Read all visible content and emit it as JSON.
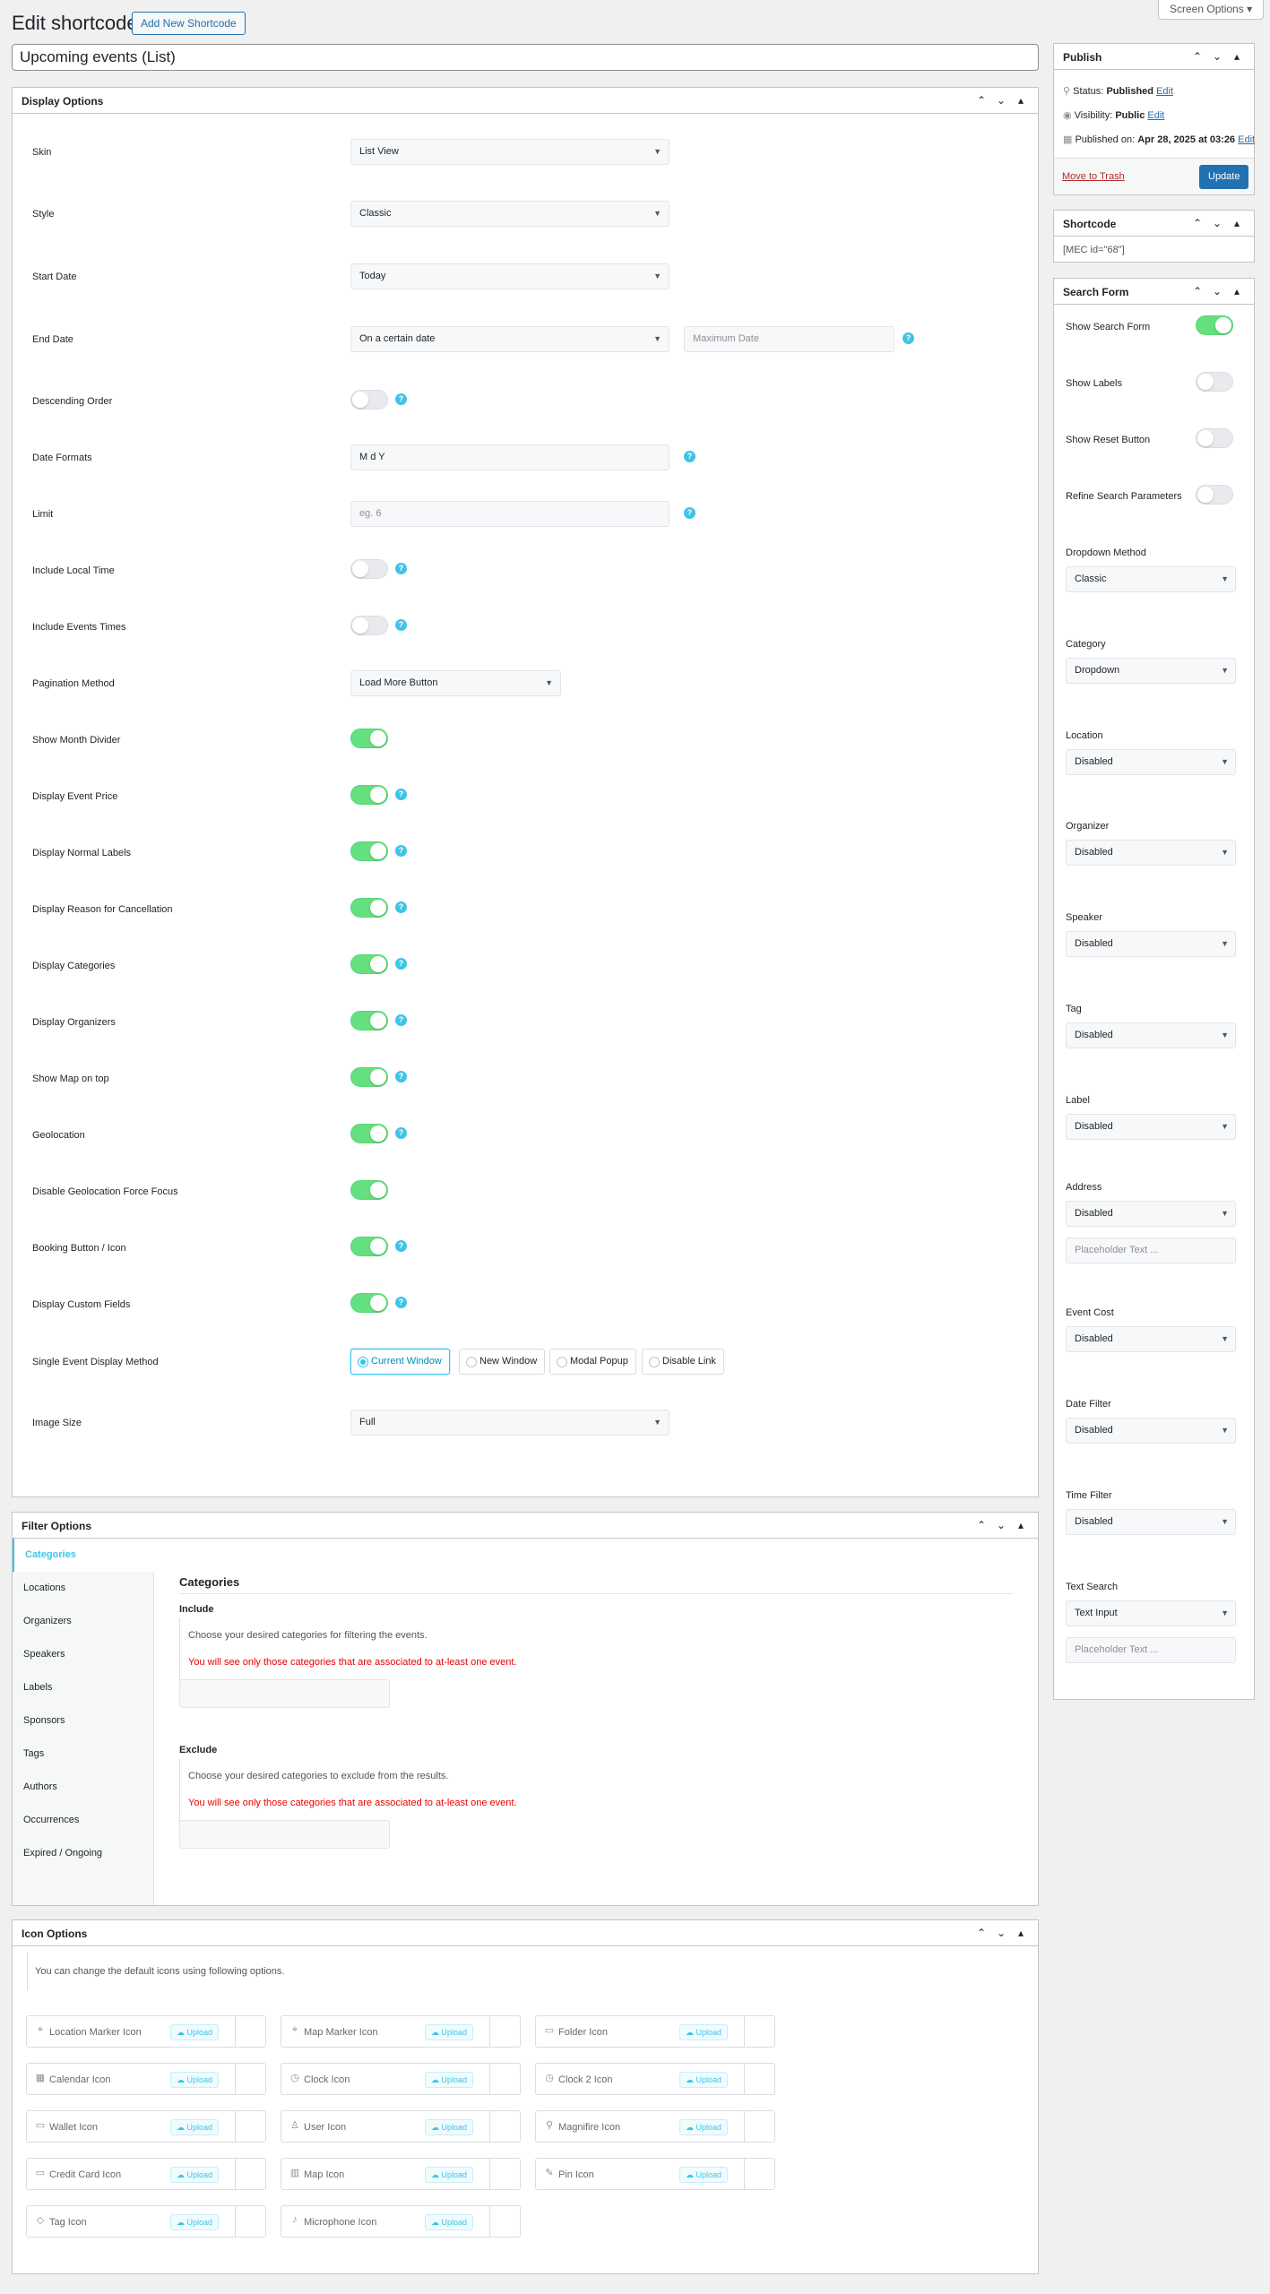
{
  "header": {
    "title": "Edit shortcodes",
    "add_new": "Add New Shortcode",
    "screen_options": "Screen Options"
  },
  "post_title": "Upcoming events (List)",
  "display_options": {
    "title": "Display Options",
    "skin": {
      "label": "Skin",
      "value": "List View"
    },
    "style": {
      "label": "Style",
      "value": "Classic"
    },
    "start_date": {
      "label": "Start Date",
      "value": "Today"
    },
    "end_date": {
      "label": "End Date",
      "value": "On a certain date",
      "max_placeholder": "Maximum Date"
    },
    "descending_order": {
      "label": "Descending Order",
      "on": false
    },
    "date_formats": {
      "label": "Date Formats",
      "value": "M d Y"
    },
    "limit": {
      "label": "Limit",
      "placeholder": "eg. 6"
    },
    "include_local_time": {
      "label": "Include Local Time",
      "on": false
    },
    "include_events_times": {
      "label": "Include Events Times",
      "on": false
    },
    "pagination": {
      "label": "Pagination Method",
      "value": "Load More Button"
    },
    "toggles": [
      {
        "label": "Show Month Divider",
        "on": true,
        "help": false
      },
      {
        "label": "Display Event Price",
        "on": true,
        "help": true
      },
      {
        "label": "Display Normal Labels",
        "on": true,
        "help": true
      },
      {
        "label": "Display Reason for Cancellation",
        "on": true,
        "help": true
      },
      {
        "label": "Display Categories",
        "on": true,
        "help": true
      },
      {
        "label": "Display Organizers",
        "on": true,
        "help": true
      },
      {
        "label": "Show Map on top",
        "on": true,
        "help": true
      },
      {
        "label": "Geolocation",
        "on": true,
        "help": true
      },
      {
        "label": "Disable Geolocation Force Focus",
        "on": true,
        "help": false
      },
      {
        "label": "Booking Button / Icon",
        "on": true,
        "help": true
      },
      {
        "label": "Display Custom Fields",
        "on": true,
        "help": true
      }
    ],
    "single_event": {
      "label": "Single Event Display Method",
      "options": [
        "Current Window",
        "New Window",
        "Modal Popup",
        "Disable Link"
      ],
      "selected": 0
    },
    "image_size": {
      "label": "Image Size",
      "value": "Full"
    }
  },
  "filter_options": {
    "title": "Filter Options",
    "tabs": [
      "Categories",
      "Locations",
      "Organizers",
      "Speakers",
      "Labels",
      "Sponsors",
      "Tags",
      "Authors",
      "Occurrences",
      "Expired / Ongoing"
    ],
    "active_tab": 0,
    "section_title": "Categories",
    "include": {
      "label": "Include",
      "desc": "Choose your desired categories for filtering the events.",
      "warn": "You will see only those categories that are associated to at-least one event."
    },
    "exclude": {
      "label": "Exclude",
      "desc": "Choose your desired categories to exclude from the results.",
      "warn": "You will see only those categories that are associated to at-least one event."
    }
  },
  "icon_options": {
    "title": "Icon Options",
    "desc": "You can change the default icons using following options.",
    "upload_label": "Upload",
    "items": [
      {
        "name": "Location Marker Icon",
        "icon": "location-marker-icon",
        "glyph": "⌖"
      },
      {
        "name": "Map Marker Icon",
        "icon": "map-marker-icon",
        "glyph": "⌖"
      },
      {
        "name": "Folder Icon",
        "icon": "folder-icon",
        "glyph": "▭"
      },
      {
        "name": "Calendar Icon",
        "icon": "calendar-icon",
        "glyph": "▦"
      },
      {
        "name": "Clock Icon",
        "icon": "clock-icon",
        "glyph": "◷"
      },
      {
        "name": "Clock 2 Icon",
        "icon": "clock-2-icon",
        "glyph": "◷"
      },
      {
        "name": "Wallet Icon",
        "icon": "wallet-icon",
        "glyph": "▭"
      },
      {
        "name": "User Icon",
        "icon": "user-icon",
        "glyph": "♙"
      },
      {
        "name": "Magnifire Icon",
        "icon": "magnifier-icon",
        "glyph": "⚲"
      },
      {
        "name": "Credit Card Icon",
        "icon": "credit-card-icon",
        "glyph": "▭"
      },
      {
        "name": "Map Icon",
        "icon": "map-icon",
        "glyph": "▥"
      },
      {
        "name": "Pin Icon",
        "icon": "pin-icon",
        "glyph": "✎"
      },
      {
        "name": "Tag Icon",
        "icon": "tag-icon",
        "glyph": "◇"
      },
      {
        "name": "Microphone Icon",
        "icon": "microphone-icon",
        "glyph": "♪"
      }
    ]
  },
  "publish": {
    "title": "Publish",
    "status_label": "Status:",
    "status_value": "Published",
    "visibility_label": "Visibility:",
    "visibility_value": "Public",
    "published_label": "Published on:",
    "published_value": "Apr 28, 2025 at 03:26",
    "edit": "Edit",
    "trash": "Move to Trash",
    "update": "Update"
  },
  "shortcode": {
    "title": "Shortcode",
    "value": "[MEC id=\"68\"]"
  },
  "search_form": {
    "title": "Search Form",
    "toggles": [
      {
        "label": "Show Search Form",
        "on": true
      },
      {
        "label": "Show Labels",
        "on": false
      },
      {
        "label": "Show Reset Button",
        "on": false
      },
      {
        "label": "Refine Search Parameters",
        "on": false
      }
    ],
    "dropdown_method": {
      "label": "Dropdown Method",
      "value": "Classic"
    },
    "fields": [
      {
        "label": "Category",
        "value": "Dropdown"
      },
      {
        "label": "Location",
        "value": "Disabled"
      },
      {
        "label": "Organizer",
        "value": "Disabled"
      },
      {
        "label": "Speaker",
        "value": "Disabled"
      },
      {
        "label": "Tag",
        "value": "Disabled"
      },
      {
        "label": "Label",
        "value": "Disabled"
      }
    ],
    "address": {
      "label": "Address",
      "value": "Disabled",
      "placeholder": "Placeholder Text ..."
    },
    "event_cost": {
      "label": "Event Cost",
      "value": "Disabled"
    },
    "date_filter": {
      "label": "Date Filter",
      "value": "Disabled"
    },
    "time_filter": {
      "label": "Time Filter",
      "value": "Disabled"
    },
    "text_search": {
      "label": "Text Search",
      "value": "Text Input",
      "placeholder": "Placeholder Text ..."
    }
  }
}
